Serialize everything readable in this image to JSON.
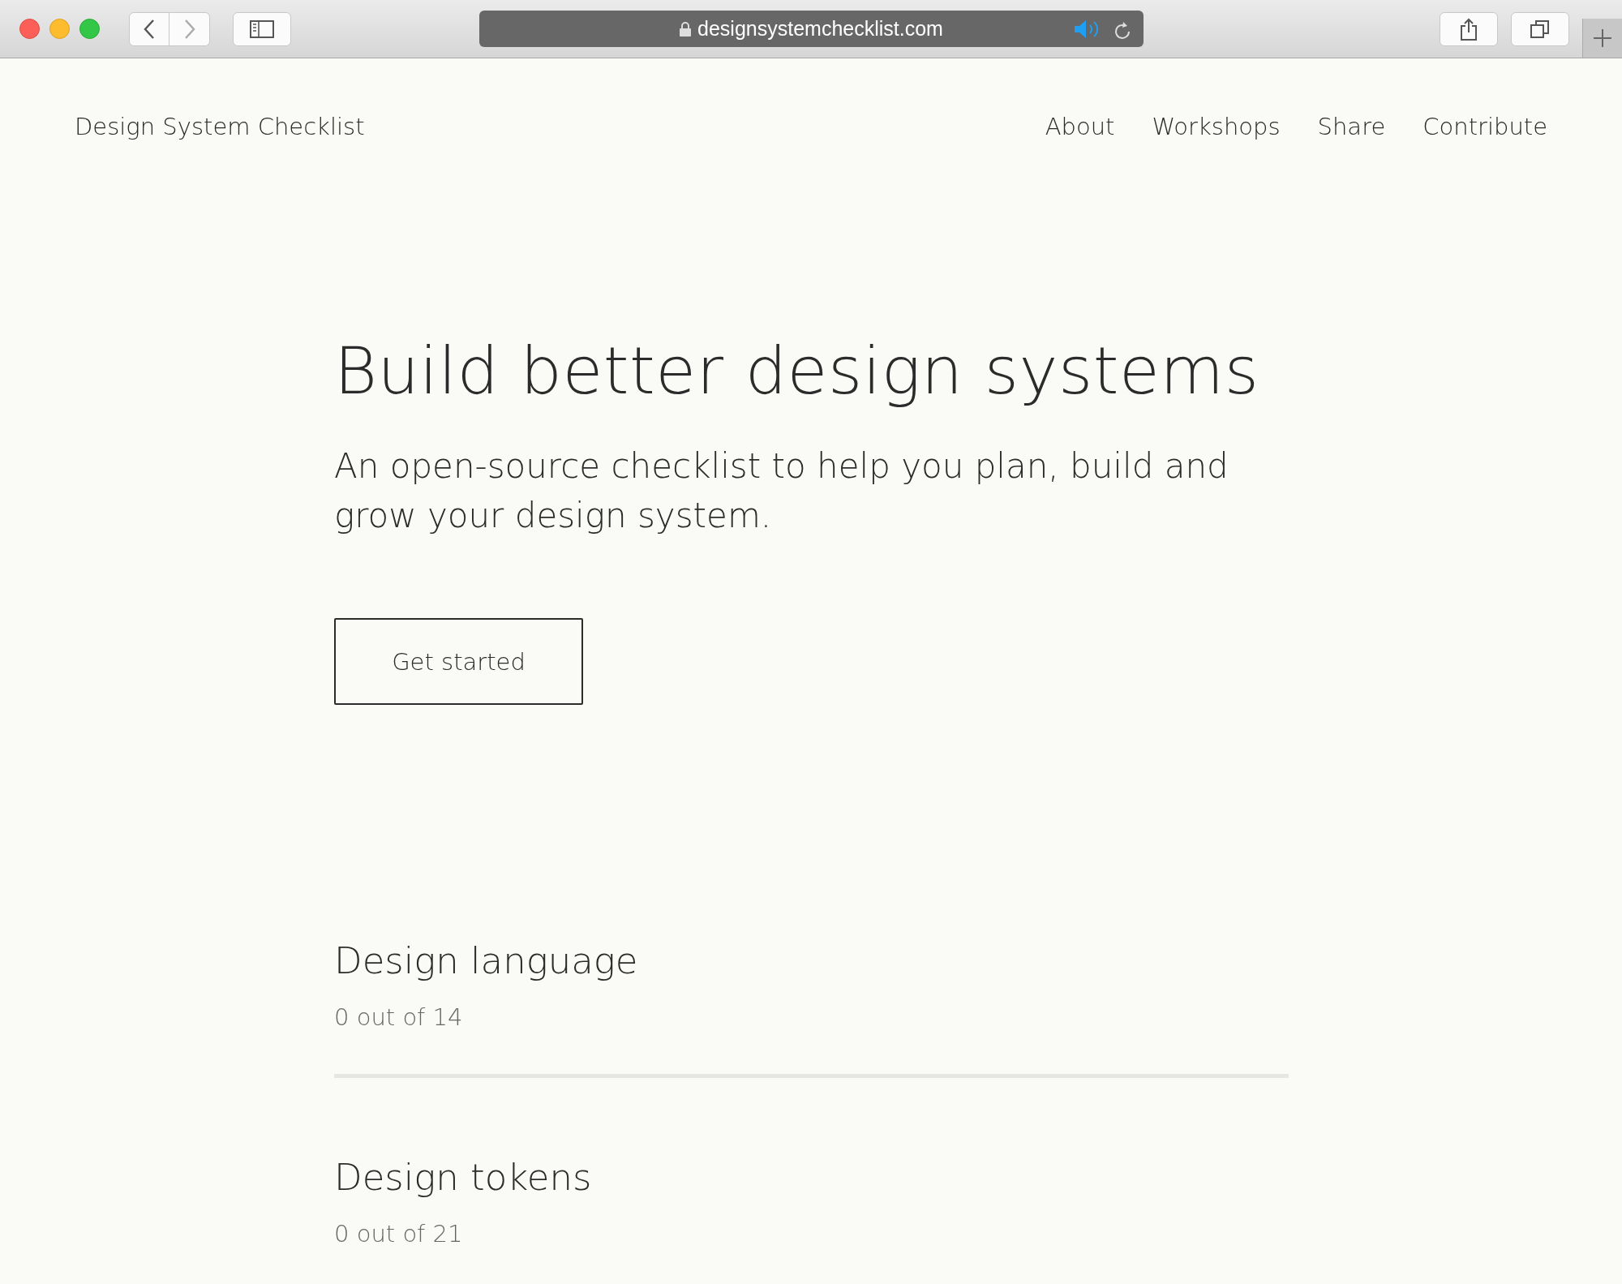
{
  "browser": {
    "url": "designsystemchecklist.com",
    "audio_playing": true
  },
  "site": {
    "logo": "Design System Checklist",
    "nav": [
      "About",
      "Workshops",
      "Share",
      "Contribute"
    ]
  },
  "hero": {
    "title": "Build better design systems",
    "subtitle": "An open-source checklist to help you plan, build and grow your design system.",
    "button": "Get started"
  },
  "sections": [
    {
      "title": "Design language",
      "count": "0 out of 14",
      "level": 0
    },
    {
      "title": "Design tokens",
      "count": "0 out of 21"
    }
  ]
}
